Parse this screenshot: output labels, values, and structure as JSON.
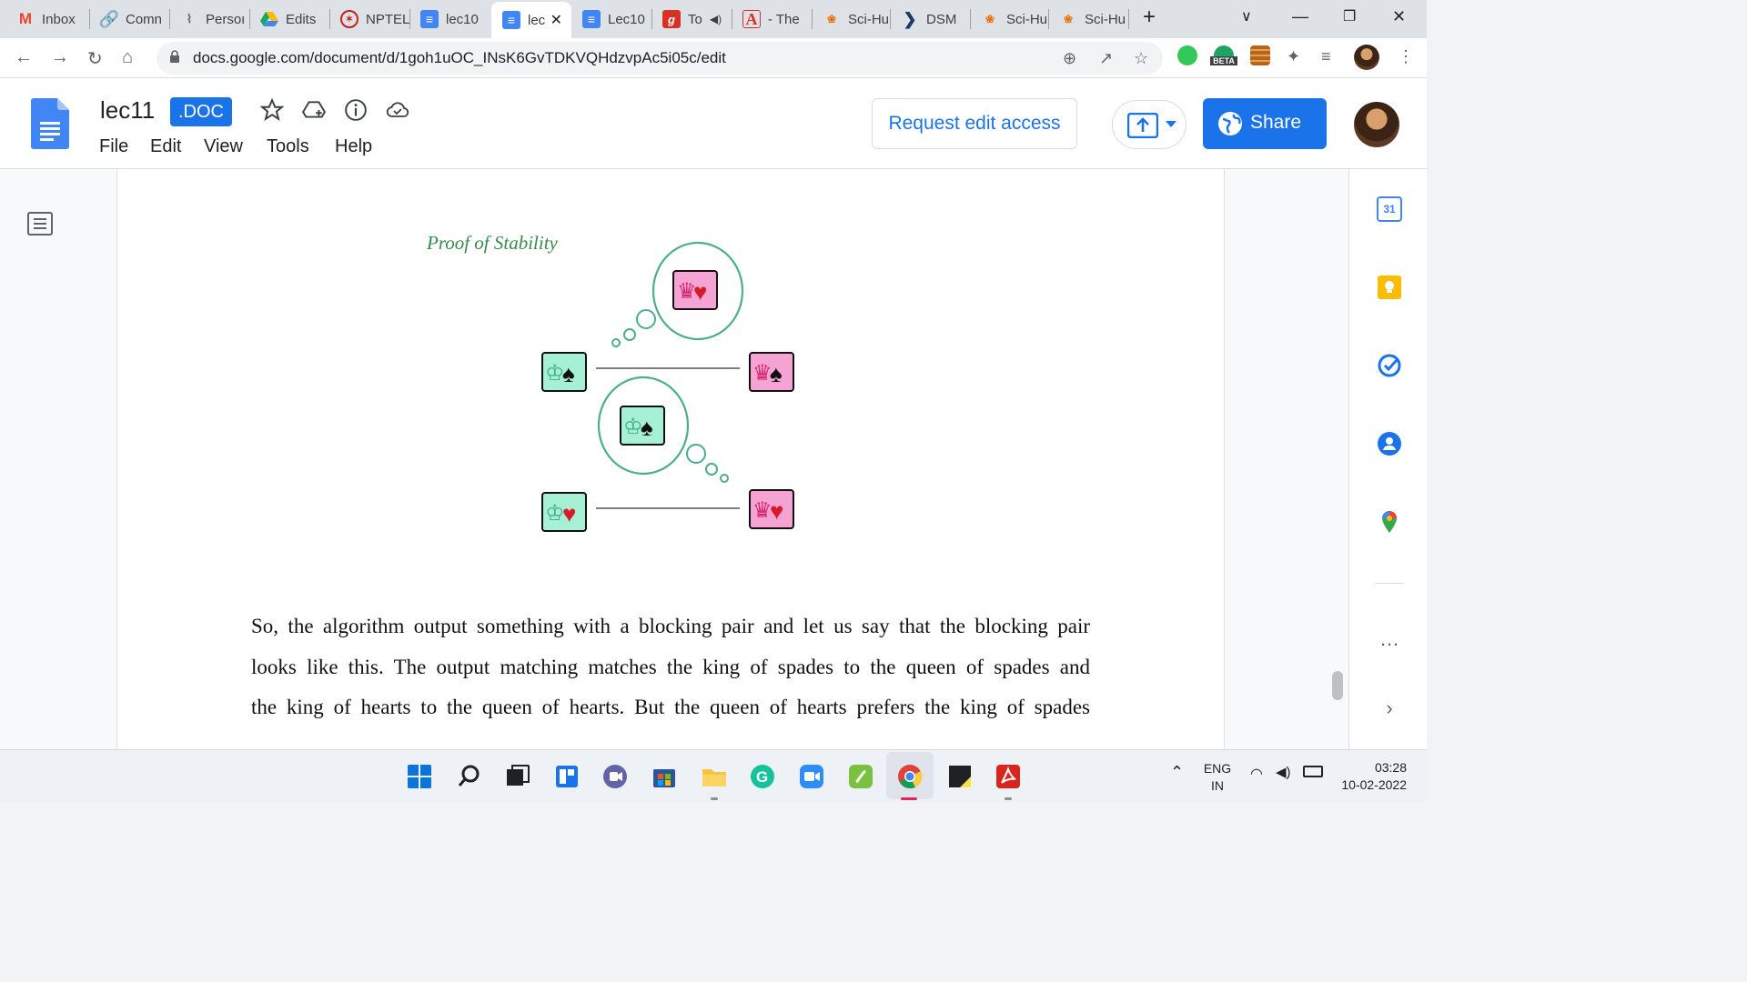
{
  "browser": {
    "tabs": [
      {
        "label": "Inbox",
        "icon": "gmail-icon",
        "color": "#ea4335"
      },
      {
        "label": "Comn",
        "icon": "link-icon",
        "color": "#1a73e8"
      },
      {
        "label": "Persoı",
        "icon": "dna-icon",
        "color": "#5f6368"
      },
      {
        "label": "Edits",
        "icon": "drive-icon",
        "color": "#fbbc04"
      },
      {
        "label": "NPTEL",
        "icon": "nptel-icon",
        "color": "#c5221f"
      },
      {
        "label": "lec10",
        "icon": "docs-icon",
        "color": "#4285f4"
      },
      {
        "label": "lec",
        "icon": "docs-icon",
        "color": "#4285f4"
      },
      {
        "label": "Lec10",
        "icon": "docs-icon",
        "color": "#4285f4"
      },
      {
        "label": "To",
        "icon": "g-icon",
        "color": "#d93025"
      },
      {
        "label": "- The",
        "icon": "acrobat-icon",
        "color": "#d93025"
      },
      {
        "label": "Sci-Hu",
        "icon": "scihub-icon",
        "color": "#e8710a"
      },
      {
        "label": "DSM",
        "icon": "dsm-icon",
        "color": "#3c4043"
      },
      {
        "label": "Sci-Hu",
        "icon": "scihub-icon",
        "color": "#e8710a"
      },
      {
        "label": "Sci-Hu",
        "icon": "scihub-icon",
        "color": "#e8710a"
      }
    ],
    "new_tab": "+",
    "url": "docs.google.com/document/d/1goh1uOC_INsK6GvTDKVQHdzvpAc5i05c/edit",
    "beta_label": "BETA"
  },
  "docs": {
    "title": "lec11",
    "badge": ".DOC",
    "menu": [
      "File",
      "Edit",
      "View",
      "Tools",
      "Help"
    ],
    "request_edit": "Request edit access",
    "share": "Share"
  },
  "document": {
    "figure_caption": "Proof of Stability",
    "paragraph_lines": [
      "So, the algorithm output something with a blocking pair and let us say that the blocking pair",
      "looks like this. The output matching matches the king of spades to the queen of spades and",
      "the king of hearts to the queen of hearts. But the queen of hearts prefers the king of spades"
    ]
  },
  "side_panel": {
    "calendar_day": "31"
  },
  "taskbar": {
    "lang_top": "ENG",
    "lang_bottom": "IN",
    "time": "03:28",
    "date": "10-02-2022"
  },
  "colors": {
    "accent": "#1a73e8",
    "king_card": "#a6f0d6",
    "queen_card": "#f4a3d2",
    "bubble_stroke": "#4caf86",
    "caption_green": "#3a8a4a"
  }
}
